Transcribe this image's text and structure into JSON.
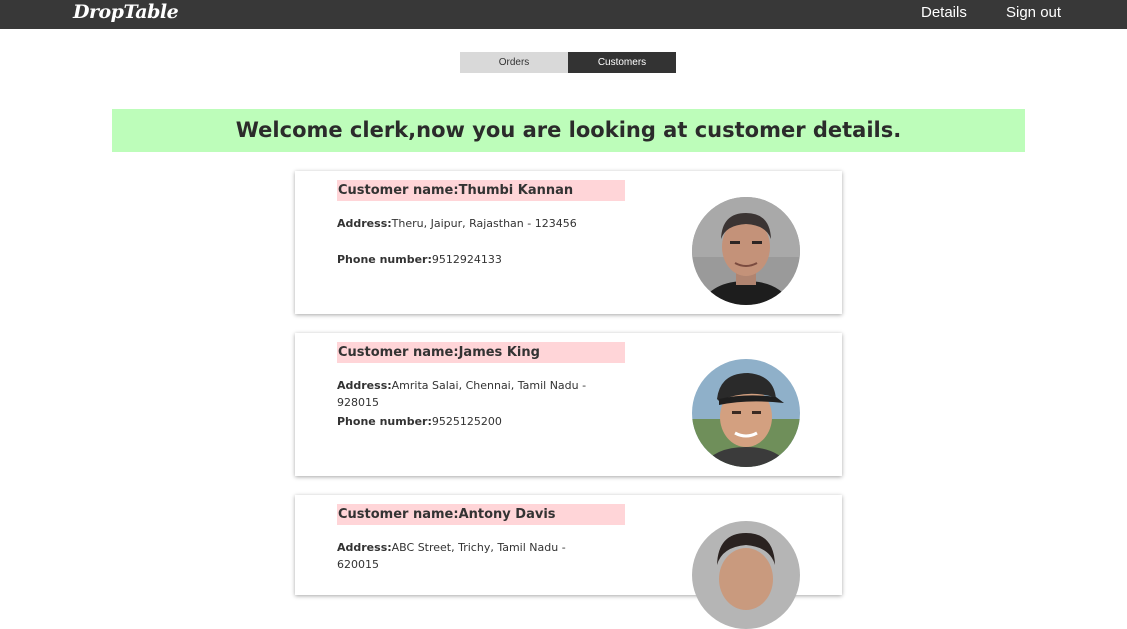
{
  "navbar": {
    "brand": "DropTable",
    "links": [
      "Details",
      "Sign out"
    ]
  },
  "tabs": [
    {
      "label": "Orders",
      "active": false
    },
    {
      "label": "Customers",
      "active": true
    }
  ],
  "banner": {
    "text": "Welcome clerk,now you are looking at customer details."
  },
  "labels": {
    "name": "Customer name:",
    "address": "Address:",
    "phone": "Phone number:"
  },
  "customers": [
    {
      "name": "Thumbi Kannan",
      "address": "Theru, Jaipur, Rajasthan - 123456",
      "phone": "9512924133"
    },
    {
      "name": "James King",
      "address": "Amrita Salai, Chennai, Tamil Nadu - 928015",
      "phone": "9525125200"
    },
    {
      "name": "Antony Davis",
      "address": "ABC Street, Trichy, Tamil Nadu - 620015",
      "phone": ""
    }
  ],
  "colors": {
    "navbar": "#383838",
    "banner": "#bdfdba",
    "name_highlight": "#ffd5d8",
    "active_tab": "#333333",
    "inactive_tab": "#d9d9d9"
  }
}
